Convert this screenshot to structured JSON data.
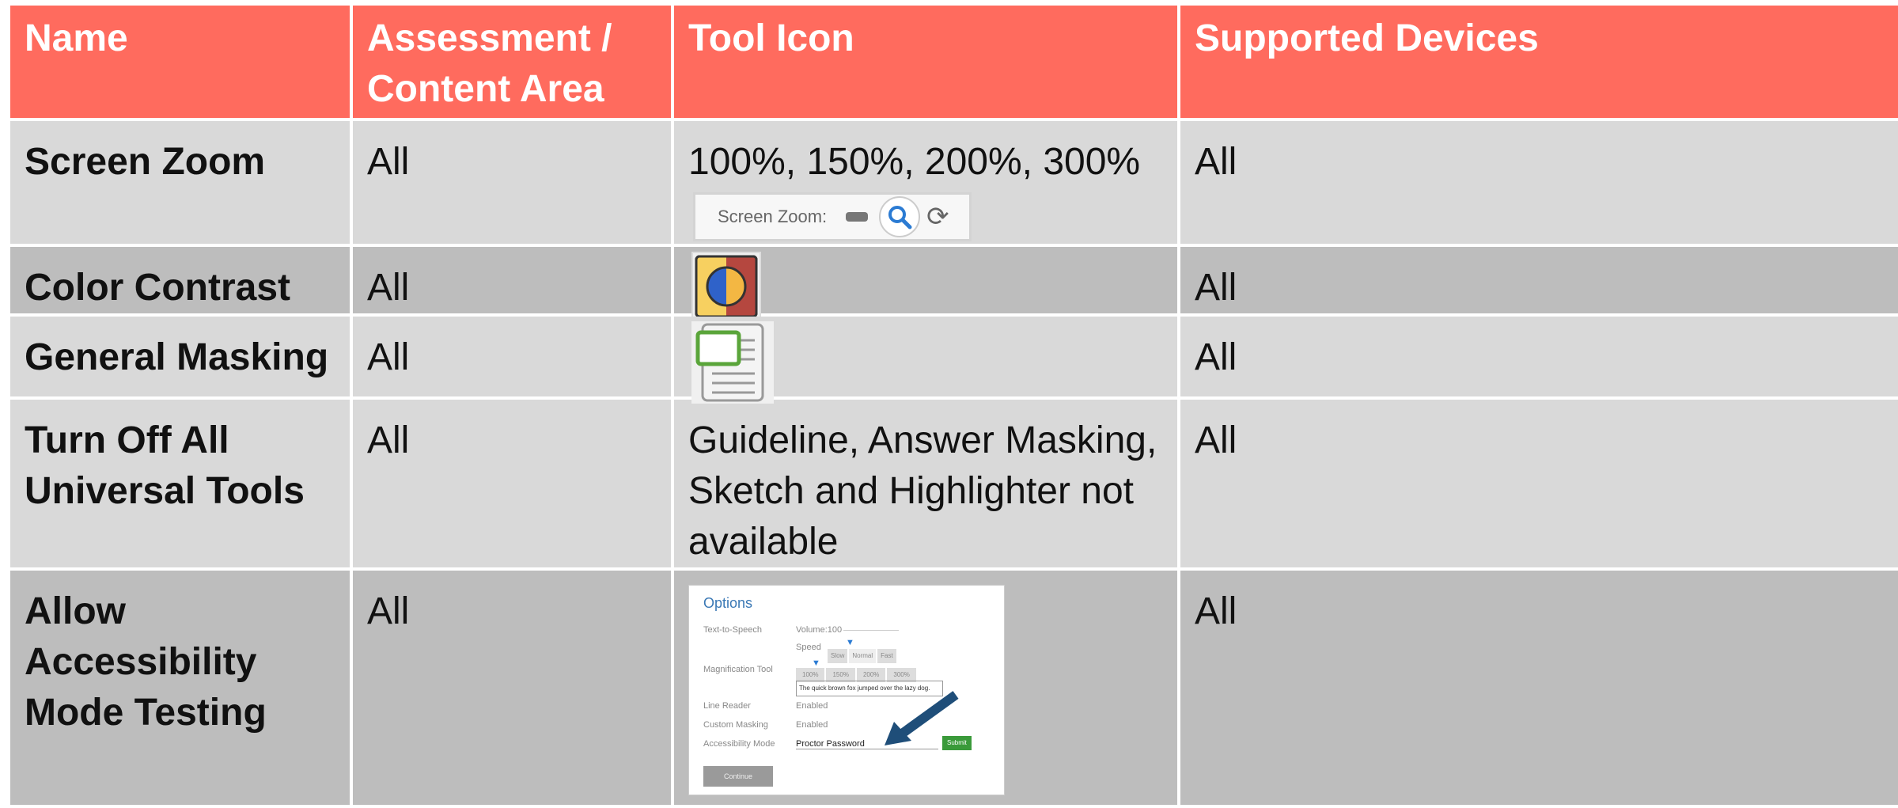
{
  "table": {
    "headers": [
      "Name",
      "Assessment / Content Area",
      "Tool Icon",
      "Supported Devices"
    ],
    "rows": [
      {
        "name": "Screen Zoom",
        "area": "All",
        "tool": "100%, 150%, 200%, 300%",
        "devices": "All"
      },
      {
        "name": "Color Contrast",
        "area": "All",
        "tool": "",
        "devices": "All"
      },
      {
        "name": "General Masking",
        "area": "All",
        "tool": "",
        "devices": "All"
      },
      {
        "name": "Turn Off All Universal Tools",
        "area": "All",
        "tool": "Guideline, Answer Masking, Sketch and Highlighter not available",
        "devices": "All"
      },
      {
        "name": "Allow Accessibility Mode Testing",
        "area": "All",
        "tool": "",
        "devices": "All"
      }
    ]
  },
  "screen_zoom_widget": {
    "label": "Screen Zoom:",
    "icons": [
      "minus-icon",
      "magnifier-icon",
      "refresh-icon"
    ]
  },
  "options_panel": {
    "title": "Options",
    "tts_label": "Text-to-Speech",
    "volume": "Volume:100",
    "speed_label": "Speed",
    "speed_options": [
      "Slow",
      "Normal",
      "Fast"
    ],
    "magnification_label": "Magnification Tool",
    "zoom_options": [
      "100%",
      "150%",
      "200%",
      "300%"
    ],
    "sample_text": "The quick brown fox jumped over the lazy dog.",
    "line_reader_label": "Line Reader",
    "line_reader_value": "Enabled",
    "custom_masking_label": "Custom Masking",
    "custom_masking_value": "Enabled",
    "accessibility_mode_label": "Accessibility Mode",
    "password_placeholder": "Proctor Password",
    "submit_label": "Submit",
    "continue_label": "Continue"
  },
  "colors": {
    "header_bg": "#ff6b5e",
    "row_light": "#d9d9d9",
    "row_dark": "#bdbdbd",
    "arrow": "#1f4e79",
    "submit": "#3a9a3a"
  }
}
